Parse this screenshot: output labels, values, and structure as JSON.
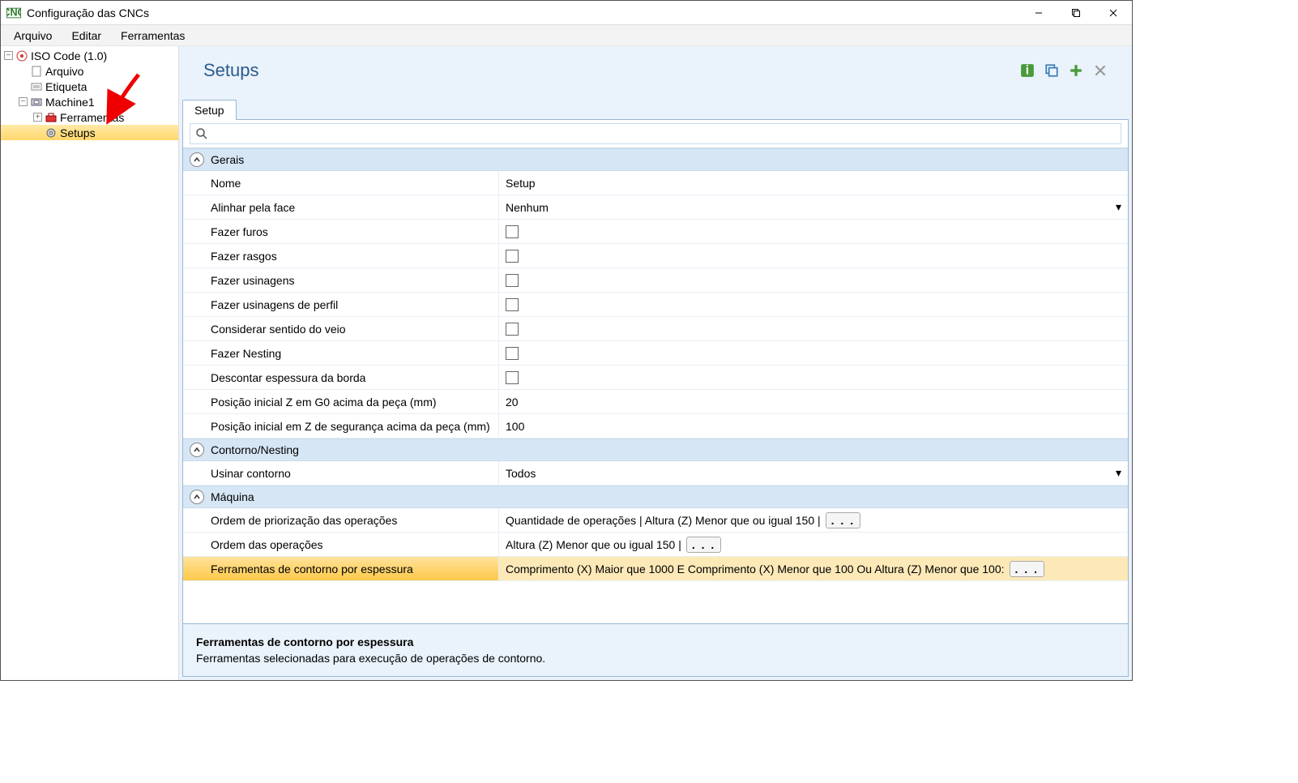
{
  "window": {
    "title": "Configuração das CNCs"
  },
  "menubar": [
    "Arquivo",
    "Editar",
    "Ferramentas"
  ],
  "tree": {
    "root": {
      "label": "ISO Code (1.0)"
    },
    "arquivo": {
      "label": "Arquivo"
    },
    "etiqueta": {
      "label": "Etiqueta"
    },
    "machine": {
      "label": "Machine1"
    },
    "ferramentas": {
      "label": "Ferramentas"
    },
    "setups": {
      "label": "Setups"
    }
  },
  "header": {
    "title": "Setups"
  },
  "tab": {
    "label": "Setup"
  },
  "search": {
    "placeholder": ""
  },
  "sections": {
    "gerais": {
      "title": "Gerais"
    },
    "contorno": {
      "title": "Contorno/Nesting"
    },
    "maquina": {
      "title": "Máquina"
    }
  },
  "props": {
    "nome": {
      "label": "Nome",
      "value": "Setup"
    },
    "alinhar": {
      "label": "Alinhar pela face",
      "value": "Nenhum"
    },
    "furos": {
      "label": "Fazer furos"
    },
    "rasgos": {
      "label": "Fazer rasgos"
    },
    "usinagens": {
      "label": "Fazer usinagens"
    },
    "usiperfil": {
      "label": "Fazer usinagens de perfil"
    },
    "veio": {
      "label": "Considerar sentido do veio"
    },
    "nesting": {
      "label": "Fazer Nesting"
    },
    "descborda": {
      "label": "Descontar espessura da borda"
    },
    "posz_g0": {
      "label": "Posição inicial Z em G0 acima da peça (mm)",
      "value": "20"
    },
    "posz_seg": {
      "label": "Posição inicial em Z de segurança acima da peça (mm)",
      "value": "100"
    },
    "usinar": {
      "label": "Usinar contorno",
      "value": "Todos"
    },
    "ordem_prio": {
      "label": "Ordem de priorização das operações",
      "value": "Quantidade de operações | Altura (Z) Menor que ou igual 150 |"
    },
    "ordem_ops": {
      "label": "Ordem das operações",
      "value": "Altura (Z) Menor que ou igual 150 |"
    },
    "ferr_cont": {
      "label": "Ferramentas de contorno por espessura",
      "value": "Comprimento (X) Maior que 1000 E Comprimento (X) Menor que 100 Ou Altura (Z) Menor que 100:"
    }
  },
  "footer": {
    "title": "Ferramentas de contorno por espessura",
    "desc": "Ferramentas selecionadas para execução de operações de contorno."
  },
  "icons": {
    "dots": ". . ."
  }
}
